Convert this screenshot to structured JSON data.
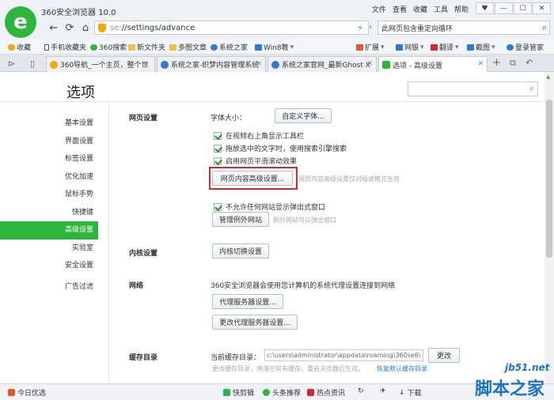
{
  "browser": {
    "app_title": "360安全浏览器 10.0",
    "top_menu": [
      "文件",
      "查看",
      "收藏",
      "工具",
      "帮助"
    ],
    "window_buttons": [
      "♥",
      "—",
      "☐",
      "✕"
    ],
    "url_scheme": "se:",
    "url_path": "//settings/advance",
    "search_value": "此网页包含重定向循环"
  },
  "favorites": {
    "left": [
      {
        "label": "收藏",
        "icon": "star-icon",
        "color": "#f4a800"
      },
      {
        "label": "手机收藏夹",
        "icon": "phone-icon",
        "color": "#555555"
      },
      {
        "label": "360搜索",
        "icon": "search-icon",
        "color": "#2db63c"
      },
      {
        "label": "新文件夹",
        "icon": "folder-icon",
        "color": "#f0c040"
      },
      {
        "label": "多图文章",
        "icon": "folder-icon",
        "color": "#f0c040"
      },
      {
        "label": "系统之家",
        "icon": "globe-icon",
        "color": "#2a7ad6"
      },
      {
        "label": "Win8教",
        "icon": "windows-icon",
        "color": "#2a7ad6"
      }
    ],
    "right": [
      {
        "label": "扩展",
        "icon": "grid-icon",
        "color": "#e05a2a"
      },
      {
        "label": "网银",
        "icon": "shield-icon",
        "color": "#2a7ad6"
      },
      {
        "label": "翻译",
        "icon": "translate-icon",
        "color": "#d9262c"
      },
      {
        "label": "截图",
        "icon": "scissors-icon",
        "color": "#2a7ad6"
      },
      {
        "label": "登录管家",
        "icon": "key-icon",
        "color": "#2a7ad6"
      }
    ]
  },
  "tabs": [
    {
      "label": "360导航_一个主页，整个世",
      "color": "#f4a800"
    },
    {
      "label": "系统之家-织梦内容管理系统",
      "color": "#2a7ad6"
    },
    {
      "label": "系统之家官网_最新Ghost X",
      "color": "#2a7ad6"
    },
    {
      "label": "选项 - 高级设置",
      "color": "#2db63c"
    }
  ],
  "options": {
    "page_title": "选项",
    "sidebar": [
      "基本设置",
      "界面设置",
      "标签设置",
      "优化加速",
      "鼠标手势",
      "快捷键",
      "高级设置",
      "实验室",
      "安全设置",
      "广告过滤"
    ],
    "active_sidebar_index": 6,
    "web": {
      "section": "网页设置",
      "font_size_label": "字体大小：",
      "custom_font_button": "自定义字体...",
      "checkboxes": [
        "在视频右上角显示工具栏",
        "拖放选中的文字时，使用搜索引擎搜索",
        "启用网页平滑滚动效果"
      ],
      "advanced_button": "网页内容高级设置...",
      "advanced_hint": "网页内容高级设置仅对极速模式生效",
      "popup_checkbox": "不允许任何网站显示弹出式窗口",
      "exceptions_button": "管理例外网站",
      "exceptions_hint": "例外网站可以弹出窗口"
    },
    "kernel": {
      "section": "内核设置",
      "button": "内核切换设置"
    },
    "network": {
      "section": "网络",
      "description": "360安全浏览器会使用您计算机的系统代理设置连接到网络",
      "proxy_button": "代理服务器设置...",
      "change_proxy_button": "更改代理服务器设置..."
    },
    "cache": {
      "section": "缓存目录",
      "current_label": "当前缓存目录：",
      "path": "c:\\users\\administrator\\appdata\\roaming\\360se6\\",
      "change_button": "更改",
      "note": "更改缓存目录，将清空现有缓存，重启浏览器后生效。",
      "restore_link": "恢复默认缓存目录"
    }
  },
  "statusbar": [
    {
      "label": "今日优选",
      "icon": "gift-icon",
      "color": "#e05a2a"
    },
    {
      "label": "快剪辑",
      "icon": "play-icon",
      "color": "#2db63c"
    },
    {
      "label": "头条推荐",
      "icon": "news-icon",
      "color": "#2db63c"
    },
    {
      "label": "热点资讯",
      "icon": "hot-icon",
      "color": "#d9262c"
    },
    {
      "label": "下载",
      "icon": "download-icon",
      "color": "#555555"
    }
  ],
  "watermark": {
    "url": "jb51.net",
    "name": "脚本之家"
  }
}
